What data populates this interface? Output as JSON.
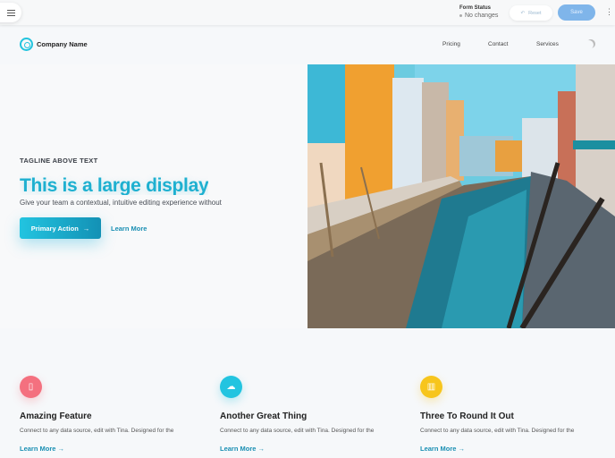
{
  "toolbar": {
    "form_status_label": "Form Status",
    "form_status_value": "No changes",
    "reset_label": "Reset",
    "save_label": "Save",
    "more_label": "⋮"
  },
  "header": {
    "company_name": "Company Name",
    "nav": [
      {
        "label": "Pricing"
      },
      {
        "label": "Contact"
      },
      {
        "label": "Services"
      }
    ]
  },
  "hero": {
    "tagline": "TAGLINE ABOVE TEXT",
    "title": "This is a large display",
    "subtitle": "Give your team a contextual, intuitive editing experience without",
    "primary_action": "Primary Action",
    "arrow": "→",
    "learn_more": "Learn More"
  },
  "features": [
    {
      "title": "Amazing Feature",
      "description": "Connect to any data source, edit with Tina. Designed for the",
      "link": "Learn More →",
      "icon": "coffee-cup-icon",
      "color": "#f4707f"
    },
    {
      "title": "Another Great Thing",
      "description": "Connect to any data source, edit with Tina. Designed for the",
      "link": "Learn More →",
      "icon": "cloud-icon",
      "color": "#22c4e0"
    },
    {
      "title": "Three To Round It Out",
      "description": "Connect to any data source, edit with Tina. Designed for the",
      "link": "Learn More →",
      "icon": "map-icon",
      "color": "#f7c51c"
    }
  ]
}
